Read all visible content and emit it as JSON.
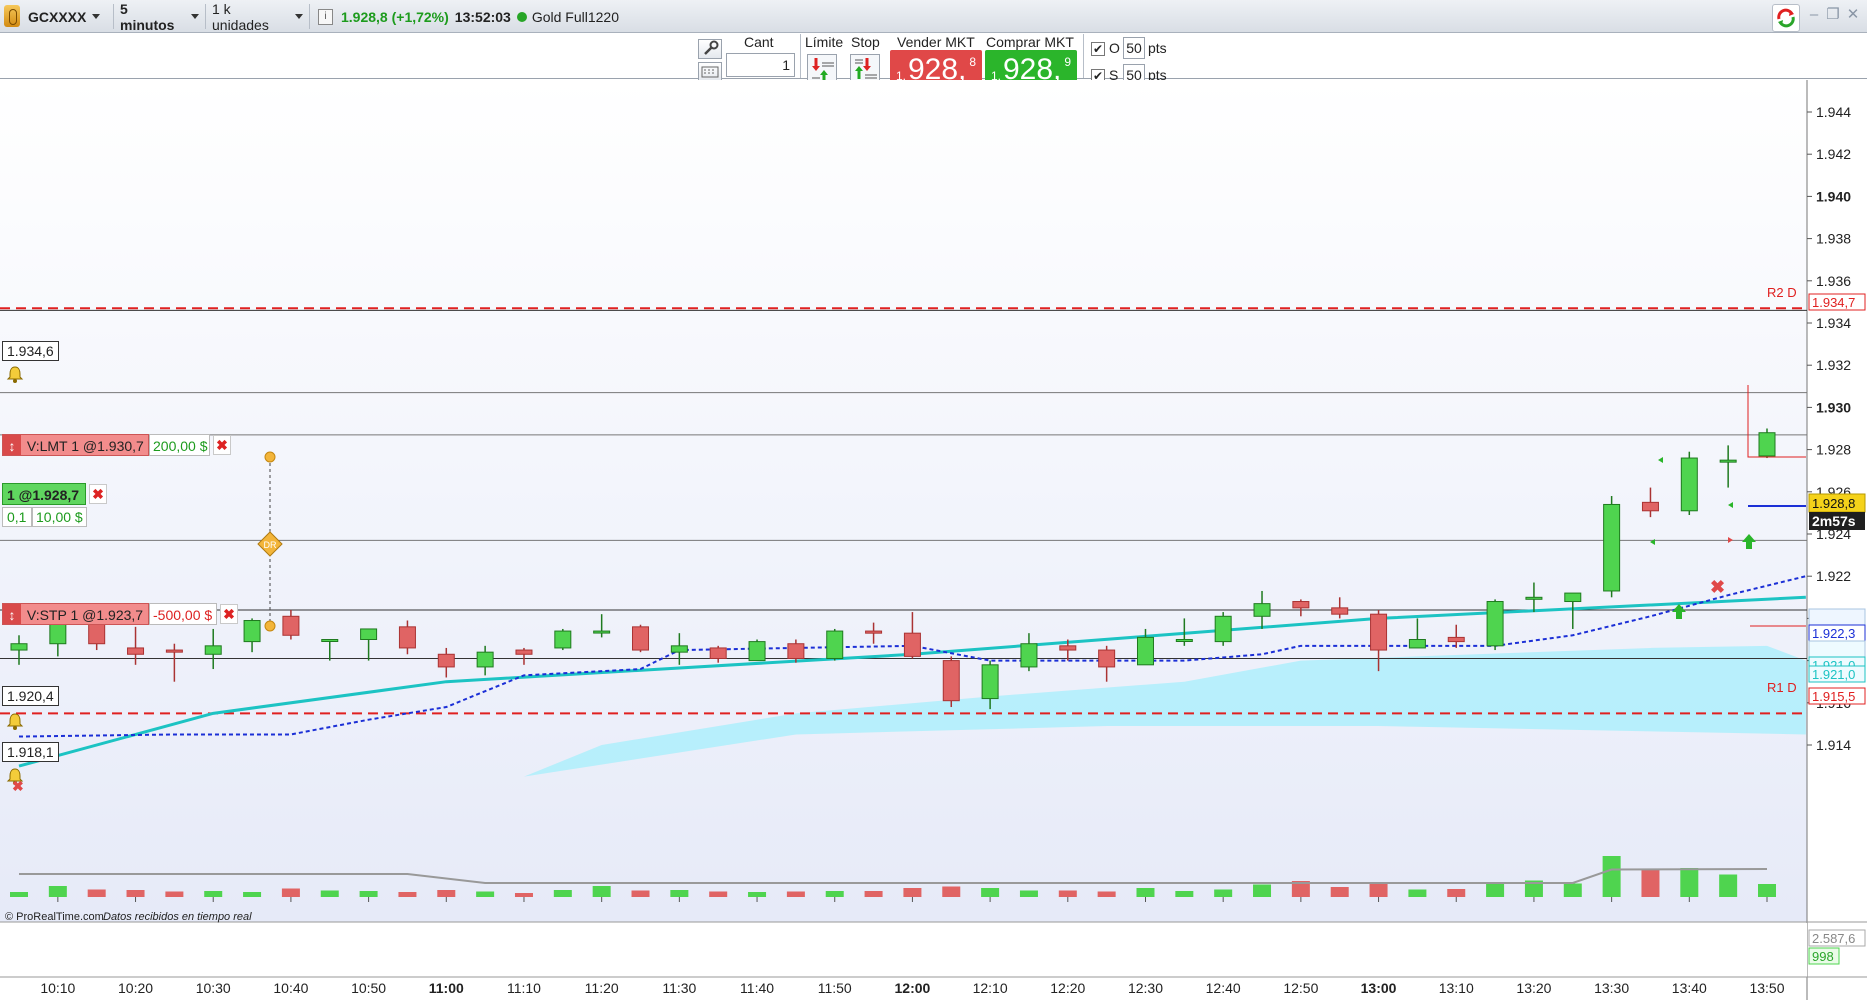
{
  "title_bar": {
    "symbol": "GCXXXX",
    "interval": "5 minutos",
    "units": "1 k unidades",
    "info_icon": "i",
    "price": "1.928,8 (+1,72%)",
    "time": "13:52:03",
    "instrument": "Gold Full1220"
  },
  "toolbar": {
    "qty_label": "Cant",
    "qty_value": "1",
    "limit_label": "Límite",
    "stop_label": "Stop",
    "sell_label": "Vender MKT",
    "sell_prefix": "1.",
    "sell_big": "928,",
    "sell_sup": "8",
    "buy_label": "Comprar MKT",
    "buy_prefix": "1.",
    "buy_big": "928,",
    "buy_sup": "9",
    "o_label": "O",
    "o_value": "50",
    "s_label": "S",
    "s_value": "50",
    "pts": "pts"
  },
  "orders": {
    "limit_label": "V:LMT 1 @1.930,7",
    "limit_value": "200,00 $",
    "position_label": "1 @1.928,7",
    "position_qty": "0,1",
    "position_value": "10,00 $",
    "stop_label": "V:STP 1 @1.923,7",
    "stop_value": "-500,00 $",
    "dr_label": "DR"
  },
  "levels": {
    "box_1934": "1.934,6",
    "box_1920": "1.920,4",
    "box_1918": "1.918,1",
    "r2_label": "R2 D",
    "r2_value": "1.934,7",
    "r1_label": "R1 D",
    "r1_value": "1.915,5",
    "current_price": "1.928,8",
    "countdown": "2m57s",
    "ma_blue": "1.922,3",
    "ma_cyan_a": "1.921,0",
    "ma_cyan_b": "1.921,0"
  },
  "y_axis": [
    "1.944",
    "1.942",
    "1.940",
    "1.938",
    "1.936",
    "1.934",
    "1.932",
    "1.930",
    "1.928",
    "1.926",
    "1.924",
    "1.922",
    "1.920",
    "1.918",
    "1.916",
    "1.914"
  ],
  "x_axis": [
    "10:10",
    "10:20",
    "10:30",
    "10:40",
    "10:50",
    "11:00",
    "11:10",
    "11:20",
    "11:30",
    "11:40",
    "11:50",
    "12:00",
    "12:10",
    "12:20",
    "12:30",
    "12:40",
    "12:50",
    "13:00",
    "13:10",
    "13:20",
    "13:30",
    "13:40",
    "13:50"
  ],
  "volume_axis": {
    "v1": "2.587,6",
    "v2": "998"
  },
  "footer": {
    "brand": "© ProRealTime.com",
    "status": "Datos recibidos en tiempo real"
  },
  "colors": {
    "bull": "#4fd44f",
    "bear": "#e06464",
    "ma_cyan": "#1cc3c3",
    "ma_blue": "#1b2fd6",
    "resistance": "#e02020",
    "cloud": "#aeeefb"
  },
  "chart_data": {
    "type": "candlestick",
    "ylim": [
      1.9125,
      1.9455
    ],
    "candles": [
      {
        "t": "10:05",
        "o": 1.9185,
        "h": 1.9192,
        "l": 1.9178,
        "c": 1.9188
      },
      {
        "t": "10:10",
        "o": 1.9188,
        "h": 1.92,
        "l": 1.9182,
        "c": 1.9198
      },
      {
        "t": "10:15",
        "o": 1.9198,
        "h": 1.9203,
        "l": 1.9185,
        "c": 1.9188
      },
      {
        "t": "10:20",
        "o": 1.9186,
        "h": 1.9196,
        "l": 1.9178,
        "c": 1.9183
      },
      {
        "t": "10:25",
        "o": 1.9185,
        "h": 1.9188,
        "l": 1.917,
        "c": 1.9184
      },
      {
        "t": "10:30",
        "o": 1.9183,
        "h": 1.9195,
        "l": 1.9176,
        "c": 1.9187
      },
      {
        "t": "10:35",
        "o": 1.9189,
        "h": 1.92,
        "l": 1.9184,
        "c": 1.9199
      },
      {
        "t": "10:40",
        "o": 1.9201,
        "h": 1.9204,
        "l": 1.919,
        "c": 1.9192
      },
      {
        "t": "10:45",
        "o": 1.919,
        "h": 1.919,
        "l": 1.918,
        "c": 1.919
      },
      {
        "t": "10:50",
        "o": 1.919,
        "h": 1.9195,
        "l": 1.918,
        "c": 1.9195
      },
      {
        "t": "10:55",
        "o": 1.9196,
        "h": 1.9199,
        "l": 1.9183,
        "c": 1.9186
      },
      {
        "t": "11:00",
        "o": 1.9183,
        "h": 1.9186,
        "l": 1.9172,
        "c": 1.9177
      },
      {
        "t": "11:05",
        "o": 1.9177,
        "h": 1.9187,
        "l": 1.9173,
        "c": 1.9184
      },
      {
        "t": "11:10",
        "o": 1.9185,
        "h": 1.9186,
        "l": 1.9178,
        "c": 1.9183
      },
      {
        "t": "11:15",
        "o": 1.9186,
        "h": 1.9195,
        "l": 1.9185,
        "c": 1.9194
      },
      {
        "t": "11:20",
        "o": 1.9194,
        "h": 1.9202,
        "l": 1.9191,
        "c": 1.9194
      },
      {
        "t": "11:25",
        "o": 1.9196,
        "h": 1.9197,
        "l": 1.9184,
        "c": 1.9185
      },
      {
        "t": "11:30",
        "o": 1.9184,
        "h": 1.9193,
        "l": 1.9178,
        "c": 1.9187
      },
      {
        "t": "11:35",
        "o": 1.9186,
        "h": 1.9187,
        "l": 1.9179,
        "c": 1.9181
      },
      {
        "t": "11:40",
        "o": 1.918,
        "h": 1.919,
        "l": 1.918,
        "c": 1.9189
      },
      {
        "t": "11:45",
        "o": 1.9188,
        "h": 1.919,
        "l": 1.9179,
        "c": 1.9181
      },
      {
        "t": "11:50",
        "o": 1.9181,
        "h": 1.9195,
        "l": 1.918,
        "c": 1.9194
      },
      {
        "t": "11:55",
        "o": 1.9194,
        "h": 1.9198,
        "l": 1.9188,
        "c": 1.9193
      },
      {
        "t": "12:00",
        "o": 1.9193,
        "h": 1.9203,
        "l": 1.9181,
        "c": 1.9182
      },
      {
        "t": "12:05",
        "o": 1.918,
        "h": 1.9182,
        "l": 1.9158,
        "c": 1.9161
      },
      {
        "t": "12:10",
        "o": 1.9162,
        "h": 1.918,
        "l": 1.9157,
        "c": 1.9178
      },
      {
        "t": "12:15",
        "o": 1.9177,
        "h": 1.9193,
        "l": 1.9175,
        "c": 1.9188
      },
      {
        "t": "12:20",
        "o": 1.9187,
        "h": 1.919,
        "l": 1.918,
        "c": 1.9185
      },
      {
        "t": "12:25",
        "o": 1.9185,
        "h": 1.9187,
        "l": 1.917,
        "c": 1.9177
      },
      {
        "t": "12:30",
        "o": 1.9178,
        "h": 1.9195,
        "l": 1.9178,
        "c": 1.9191
      },
      {
        "t": "12:35",
        "o": 1.919,
        "h": 1.92,
        "l": 1.9187,
        "c": 1.919
      },
      {
        "t": "12:40",
        "o": 1.9189,
        "h": 1.9203,
        "l": 1.9187,
        "c": 1.9201
      },
      {
        "t": "12:45",
        "o": 1.9201,
        "h": 1.9213,
        "l": 1.9195,
        "c": 1.9207
      },
      {
        "t": "12:50",
        "o": 1.9208,
        "h": 1.9209,
        "l": 1.9201,
        "c": 1.9205
      },
      {
        "t": "12:55",
        "o": 1.9205,
        "h": 1.921,
        "l": 1.92,
        "c": 1.9202
      },
      {
        "t": "13:00",
        "o": 1.9202,
        "h": 1.9204,
        "l": 1.9175,
        "c": 1.9185
      },
      {
        "t": "13:05",
        "o": 1.9186,
        "h": 1.92,
        "l": 1.9186,
        "c": 1.919
      },
      {
        "t": "13:10",
        "o": 1.9191,
        "h": 1.9197,
        "l": 1.9186,
        "c": 1.9189
      },
      {
        "t": "13:15",
        "o": 1.9187,
        "h": 1.9209,
        "l": 1.9185,
        "c": 1.9208
      },
      {
        "t": "13:20",
        "o": 1.921,
        "h": 1.9217,
        "l": 1.9203,
        "c": 1.921
      },
      {
        "t": "13:25",
        "o": 1.9208,
        "h": 1.9212,
        "l": 1.9195,
        "c": 1.9212
      },
      {
        "t": "13:30",
        "o": 1.9213,
        "h": 1.9258,
        "l": 1.921,
        "c": 1.9254
      },
      {
        "t": "13:35",
        "o": 1.9255,
        "h": 1.9262,
        "l": 1.9248,
        "c": 1.9251
      },
      {
        "t": "13:40",
        "o": 1.9251,
        "h": 1.9279,
        "l": 1.9249,
        "c": 1.9276
      },
      {
        "t": "13:45",
        "o": 1.9275,
        "h": 1.9282,
        "l": 1.9262,
        "c": 1.9275
      },
      {
        "t": "13:50",
        "o": 1.9277,
        "h": 1.929,
        "l": 1.9276,
        "c": 1.9288
      }
    ],
    "ma_cyan": [
      [
        0,
        1.913
      ],
      [
        5,
        1.9155
      ],
      [
        11,
        1.917
      ],
      [
        23,
        1.9183
      ],
      [
        35,
        1.92
      ],
      [
        46,
        1.921
      ]
    ],
    "ma_blue": [
      [
        0,
        1.9144
      ],
      [
        4,
        1.9145
      ],
      [
        7,
        1.9145
      ],
      [
        9,
        1.9152
      ],
      [
        11,
        1.9158
      ],
      [
        13,
        1.9173
      ],
      [
        16,
        1.9176
      ],
      [
        17,
        1.9185
      ],
      [
        23,
        1.9187
      ],
      [
        25,
        1.918
      ],
      [
        30,
        1.918
      ],
      [
        32,
        1.9183
      ],
      [
        33,
        1.9187
      ],
      [
        38,
        1.9187
      ],
      [
        40,
        1.9192
      ],
      [
        42,
        1.9201
      ],
      [
        44,
        1.9211
      ],
      [
        46,
        1.922
      ]
    ],
    "cloud_top": [
      [
        13,
        1.9125
      ],
      [
        15,
        1.914
      ],
      [
        20,
        1.9155
      ],
      [
        25,
        1.9163
      ],
      [
        30,
        1.917
      ],
      [
        33,
        1.918
      ],
      [
        36,
        1.9182
      ],
      [
        42,
        1.9186
      ],
      [
        45,
        1.9187
      ],
      [
        46,
        1.918
      ]
    ],
    "cloud_bottom": [
      [
        13,
        1.9125
      ],
      [
        20,
        1.9145
      ],
      [
        28,
        1.9149
      ],
      [
        35,
        1.9149
      ],
      [
        46,
        1.9145
      ]
    ],
    "volume": [
      0.1,
      0.22,
      0.15,
      0.14,
      0.11,
      0.12,
      0.1,
      0.17,
      0.13,
      0.12,
      0.1,
      0.14,
      0.11,
      0.08,
      0.14,
      0.22,
      0.13,
      0.14,
      0.11,
      0.1,
      0.11,
      0.12,
      0.12,
      0.18,
      0.21,
      0.18,
      0.13,
      0.13,
      0.11,
      0.18,
      0.12,
      0.15,
      0.25,
      0.32,
      0.2,
      0.28,
      0.15,
      0.16,
      0.26,
      0.33,
      0.27,
      0.82,
      0.55,
      0.58,
      0.45,
      0.26
    ]
  }
}
